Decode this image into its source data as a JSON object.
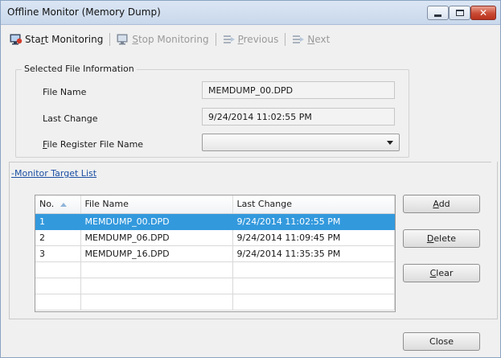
{
  "window": {
    "title": "Offline Monitor (Memory Dump)",
    "controls": {
      "minimize": "minimize-icon",
      "maximize": "maximize-icon",
      "close": "close-icon",
      "close_color": "#c94a33"
    }
  },
  "toolbar": {
    "start_monitoring": {
      "mnemonic_prefix": "Sta",
      "mnemonic": "r",
      "suffix": "t Monitoring",
      "enabled": true,
      "icon": "monitor-icon"
    },
    "stop_monitoring": {
      "mnemonic_prefix": "",
      "mnemonic": "S",
      "suffix": "top Monitoring",
      "enabled": false,
      "icon": "monitor-icon"
    },
    "previous": {
      "mnemonic_prefix": "",
      "mnemonic": "P",
      "suffix": "revious",
      "enabled": false,
      "icon": "previous-icon"
    },
    "next": {
      "mnemonic_prefix": "",
      "mnemonic": "N",
      "suffix": "ext",
      "enabled": false,
      "icon": "next-icon"
    }
  },
  "selected_file_info": {
    "group_title": "Selected File Information",
    "file_name_label": "File Name",
    "file_name_value": "MEMDUMP_00.DPD",
    "last_change_label": "Last Change",
    "last_change_value": "9/24/2014 11:02:55 PM",
    "register_label_mnemonic": "F",
    "register_label_rest": "ile Register File Name",
    "register_value": ""
  },
  "monitor_target": {
    "link_prefix": "-Monitor Tar",
    "link_mnemonic": "g",
    "link_suffix": "et List",
    "columns": [
      "No.",
      "File Name",
      "Last Change"
    ],
    "rows": [
      [
        "1",
        "MEMDUMP_00.DPD",
        "9/24/2014 11:02:55 PM"
      ],
      [
        "2",
        "MEMDUMP_06.DPD",
        "9/24/2014 11:09:45 PM"
      ],
      [
        "3",
        "MEMDUMP_16.DPD",
        "9/24/2014 11:35:35 PM"
      ],
      [
        "",
        "",
        ""
      ],
      [
        "",
        "",
        ""
      ],
      [
        "",
        "",
        ""
      ]
    ],
    "selected_row": 1,
    "selection_color": "#3399dd"
  },
  "buttons": {
    "add": {
      "mnemonic": "A",
      "rest": "dd"
    },
    "delete": {
      "mnemonic": "D",
      "rest": "elete"
    },
    "clear": {
      "mnemonic": "C",
      "rest": "lear"
    },
    "close": "Close"
  }
}
